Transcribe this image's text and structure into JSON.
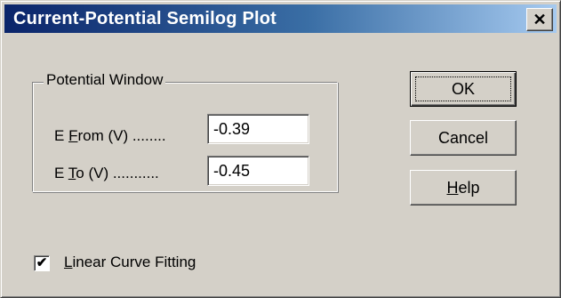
{
  "dialog": {
    "title": "Current-Potential Semilog Plot",
    "close_glyph": "✕"
  },
  "potential_window": {
    "legend": "Potential Window",
    "e_from": {
      "label_prefix": "E ",
      "label_mnemonic": "F",
      "label_rest": "rom (V) ........",
      "value": "-0.39"
    },
    "e_to": {
      "label_prefix": "E ",
      "label_mnemonic": "T",
      "label_rest": "o (V) ...........",
      "value": "-0.45"
    }
  },
  "buttons": {
    "ok": "OK",
    "cancel": "Cancel",
    "help_mnemonic": "H",
    "help_rest": "elp"
  },
  "linear_fit": {
    "checked": true,
    "check_glyph": "✔",
    "label_mnemonic": "L",
    "label_rest": "inear Curve Fitting"
  },
  "icons": {
    "close": "close-icon",
    "check": "checkmark-icon"
  }
}
